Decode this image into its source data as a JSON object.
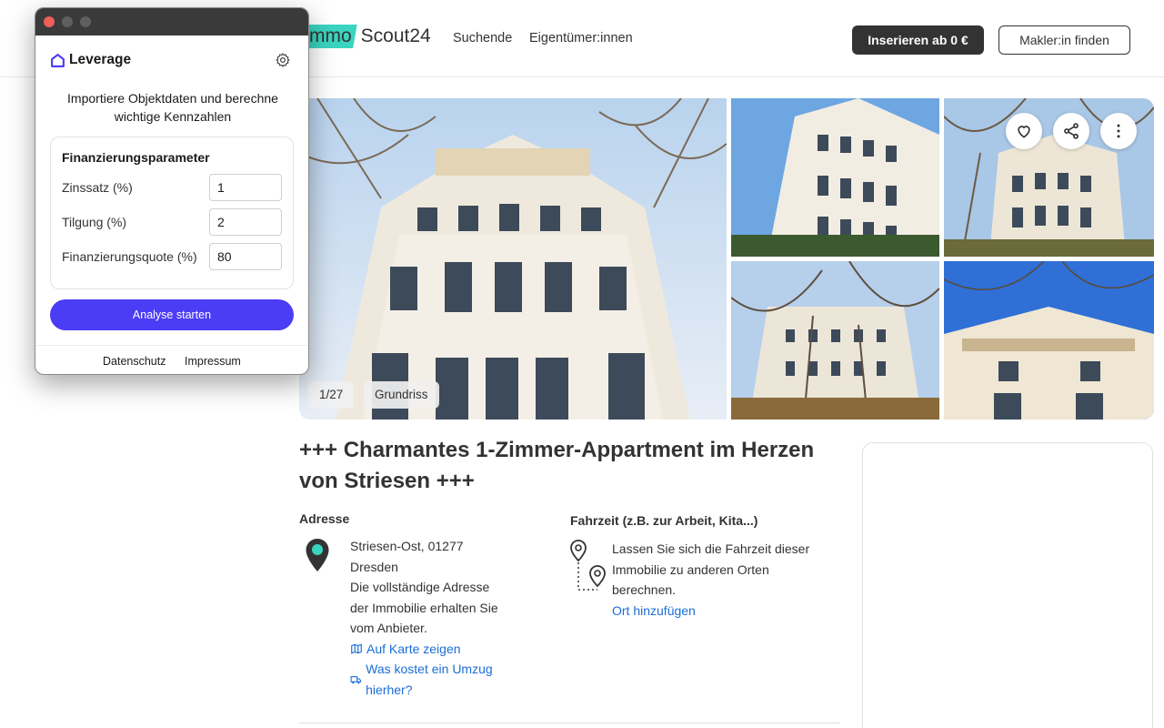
{
  "header": {
    "logo_left": "mmo",
    "logo_right": "Scout24",
    "nav_searchers": "Suchende",
    "nav_owners": "Eigentümer:innen",
    "cta_insert": "Inserieren ab 0 €",
    "cta_find_agent": "Makler:in finden"
  },
  "gallery": {
    "counter": "1/27",
    "floorplan": "Grundriss",
    "icons": [
      "heart-icon",
      "share-icon",
      "more-icon"
    ]
  },
  "listing": {
    "title": "+++ Charmantes 1-Zimmer-Appartment im Herzen von Striesen +++",
    "address_heading": "Adresse",
    "address_line1": "Striesen-Ost, 01277",
    "address_line2": "Dresden",
    "address_note": "Die vollständige Adresse der Immobilie erhalten Sie vom Anbieter.",
    "map_link": "Auf Karte zeigen",
    "moving_link": "Was kostet ein Umzug hierher?",
    "commute_heading": "Fahrzeit (z.B. zur Arbeit, Kita...)",
    "commute_text": "Lassen Sie sich die Fahrzeit dieser Immobilie zu anderen Orten berechnen.",
    "commute_link": "Ort hinzufügen"
  },
  "popup": {
    "brand": "Leverage",
    "intro": "Importiere Objektdaten und berechne wichtige Kennzahlen",
    "section_title": "Finanzierungsparameter",
    "fields": [
      {
        "label": "Zinssatz (%)",
        "value": "1"
      },
      {
        "label": "Tilgung (%)",
        "value": "2"
      },
      {
        "label": "Finanzierungsquote (%)",
        "value": "80"
      }
    ],
    "button": "Analyse starten",
    "footer_privacy": "Datenschutz",
    "footer_imprint": "Impressum"
  },
  "colors": {
    "accent": "#4b3cf5",
    "brand_teal": "#3ad5c0",
    "link": "#1a6ed8",
    "dark_button": "#333333"
  }
}
